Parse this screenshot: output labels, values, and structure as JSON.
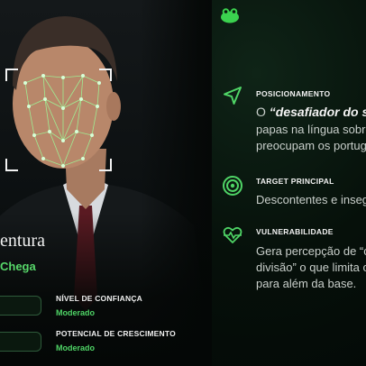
{
  "portrait": {
    "name_partial": "entura",
    "party_partial": "Chega"
  },
  "stats": [
    {
      "label": "NÍVEL DE CONFIANÇA",
      "value": "Moderado"
    },
    {
      "label": "POTENCIAL DE CRESCIMENTO",
      "value": "Moderado"
    }
  ],
  "logo": {
    "icon": "frog-logo-icon",
    "color": "#3bd24f"
  },
  "sections": [
    {
      "icon": "navigation-arrow-icon",
      "title": "POSICIONAMENTO",
      "line1_prefix": "O ",
      "line1_emph": "“desafiador do si",
      "line2": "papas na língua sobre",
      "line3": "preocupam os portug"
    },
    {
      "icon": "target-icon",
      "title": "TARGET PRINCIPAL",
      "line1": "Descontentes e inseg"
    },
    {
      "icon": "heartbeat-icon",
      "title": "VULNERABILIDADE",
      "line1": "Gera percepção de “c",
      "line2": "divisão” o que limita c",
      "line3": "para além da base."
    }
  ],
  "colors": {
    "accent": "#4fd466",
    "background": "#050807",
    "text": "#c9cfcb"
  }
}
